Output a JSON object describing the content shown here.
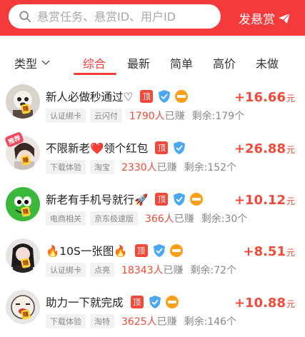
{
  "search": {
    "placeholder": "悬赏任务、悬赏ID、用户ID"
  },
  "header": {
    "post_label": "发悬赏"
  },
  "filters": {
    "type_label": "类型",
    "tabs": [
      "综合",
      "最新",
      "简单",
      "高价",
      "未做"
    ],
    "active_tab": "综合"
  },
  "badges": {
    "top": "顶"
  },
  "labels": {
    "earned_suffix": "已赚",
    "remaining_prefix": "剩余:",
    "remaining_suffix": "个",
    "currency_unit": "元"
  },
  "items": [
    {
      "title": "新人必做秒通过♡",
      "tags": [
        "认证绑卡",
        "云闪付"
      ],
      "earned": "1790人",
      "remaining": "179",
      "reward": "+16.66",
      "avatar_tag": "赚"
    },
    {
      "title": "不限新老❤️领个红包",
      "tags": [
        "下载体验",
        "淘宝"
      ],
      "earned": "2330人",
      "remaining": "152",
      "reward": "+26.88",
      "avatar_tag": "赚",
      "rec_tag": "推荐"
    },
    {
      "title": "新老有手机号就行🚀",
      "tags": [
        "电商相关",
        "京东极速版"
      ],
      "earned": "366人",
      "remaining": "30",
      "reward": "+10.12",
      "avatar_tag": "赚"
    },
    {
      "title": "🔥10S一张图🔥",
      "tags": [
        "认证绑卡",
        "点亮"
      ],
      "earned": "18343人",
      "remaining": "72",
      "reward": "+8.51",
      "avatar_tag": "赚"
    },
    {
      "title": "助力一下就完成",
      "tags": [
        "下载体验",
        "淘特"
      ],
      "earned": "3625人",
      "remaining": "146",
      "reward": "+10.88",
      "avatar_tag": "赚"
    }
  ],
  "colors": {
    "brand": "#f43a3a",
    "badge_blue": "#4aa8f2",
    "badge_orange": "#ff9f1a"
  }
}
